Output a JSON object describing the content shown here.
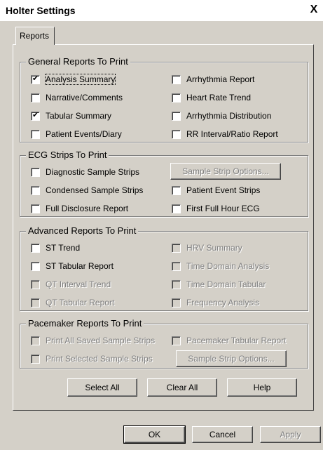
{
  "window": {
    "title": "Holter Settings",
    "close": "X"
  },
  "tabs": [
    {
      "label": "Reports"
    }
  ],
  "general": {
    "legend": "General Reports To Print",
    "left": [
      {
        "label": "Analysis Summary",
        "checked": true
      },
      {
        "label": "Narrative/Comments",
        "checked": false
      },
      {
        "label": "Tabular Summary",
        "checked": true
      },
      {
        "label": "Patient Events/Diary",
        "checked": false
      }
    ],
    "right": [
      {
        "label": "Arrhythmia Report",
        "checked": false
      },
      {
        "label": "Heart Rate Trend",
        "checked": false
      },
      {
        "label": "Arrhythmia Distribution",
        "checked": false
      },
      {
        "label": "RR Interval/Ratio Report",
        "checked": false
      }
    ]
  },
  "ecg": {
    "legend": "ECG Strips To Print",
    "left": [
      {
        "label": "Diagnostic Sample Strips",
        "checked": false
      },
      {
        "label": "Condensed Sample Strips",
        "checked": false
      },
      {
        "label": "Full Disclosure Report",
        "checked": false
      }
    ],
    "sample_button": "Sample Strip Options...",
    "right": [
      {
        "label": "Patient Event Strips",
        "checked": false
      },
      {
        "label": "First Full Hour ECG",
        "checked": false
      }
    ]
  },
  "advanced": {
    "legend": "Advanced Reports To Print",
    "left": [
      {
        "label": "ST Trend",
        "checked": false,
        "enabled": true
      },
      {
        "label": "ST Tabular Report",
        "checked": false,
        "enabled": true
      },
      {
        "label": "QT Interval Trend",
        "checked": false,
        "enabled": false
      },
      {
        "label": "QT Tabular Report",
        "checked": false,
        "enabled": false
      }
    ],
    "right": [
      {
        "label": "HRV Summary",
        "checked": false,
        "enabled": false
      },
      {
        "label": "Time Domain Analysis",
        "checked": false,
        "enabled": false
      },
      {
        "label": "Time Domain Tabular",
        "checked": false,
        "enabled": false
      },
      {
        "label": "Frequency Analysis",
        "checked": false,
        "enabled": false
      }
    ]
  },
  "pacemaker": {
    "legend": "Pacemaker Reports To Print",
    "items": [
      {
        "label": "Print All Saved Sample Strips"
      },
      {
        "label": "Pacemaker Tabular Report"
      },
      {
        "label": "Print Selected Sample Strips"
      }
    ],
    "sample_button": "Sample Strip Options..."
  },
  "actions": {
    "select_all": "Select All",
    "clear_all": "Clear All",
    "help": "Help"
  },
  "footer": {
    "ok": "OK",
    "cancel": "Cancel",
    "apply": "Apply"
  }
}
